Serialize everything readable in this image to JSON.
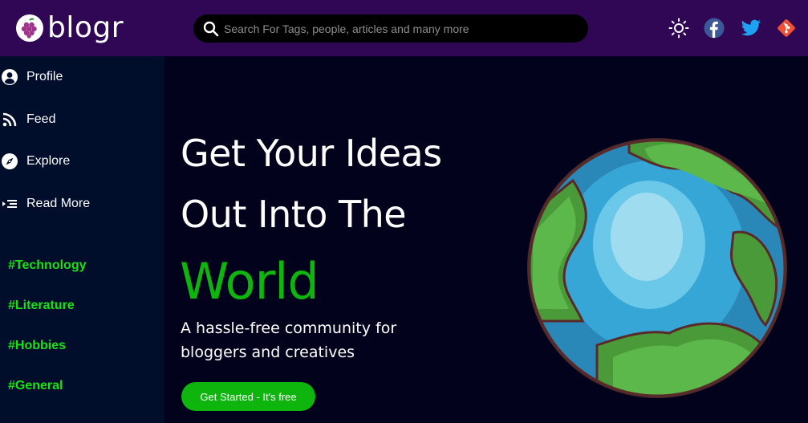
{
  "brand": {
    "name": "blogr"
  },
  "search": {
    "placeholder": "Search For Tags, people, articles and many more"
  },
  "header_icons": [
    "theme-toggle-sun-icon",
    "facebook-icon",
    "twitter-icon",
    "git-icon"
  ],
  "colors": {
    "topbar": "#300755",
    "sidebar": "#000d2b",
    "background": "#02021c",
    "accent_green": "#0db50d",
    "tag_green": "#17e314"
  },
  "sidebar": {
    "items": [
      {
        "label": "Profile",
        "icon": "user-circle-icon"
      },
      {
        "label": "Feed",
        "icon": "rss-icon"
      },
      {
        "label": "Explore",
        "icon": "compass-icon"
      },
      {
        "label": "Read More",
        "icon": "read-more-icon"
      }
    ],
    "tags": [
      "#Technology",
      "#Literature",
      "#Hobbies",
      "#General"
    ]
  },
  "hero": {
    "line1": "Get Your Ideas",
    "line2": "Out Into The",
    "accent": "World",
    "sub1": "A hassle-free community for",
    "sub2": "bloggers and creatives",
    "cta": "Get Started - It's free"
  }
}
